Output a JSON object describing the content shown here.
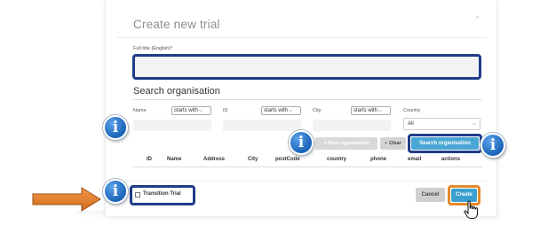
{
  "modal": {
    "title": "Create new trial",
    "close_icon": "close-icon"
  },
  "full_title": {
    "label": "Full title (English)*",
    "value": ""
  },
  "search": {
    "section_title": "Search organisation",
    "name": {
      "label": "Name",
      "operator": "starts with",
      "value": ""
    },
    "id": {
      "label": "ID",
      "operator": "starts with",
      "value": ""
    },
    "city": {
      "label": "City",
      "operator": "starts with",
      "value": ""
    },
    "country": {
      "label": "Country",
      "value": "All"
    },
    "new_org_label": "+ New organisation",
    "clear_label": "Clear",
    "search_label": "Search organisation"
  },
  "table": {
    "columns": [
      "ID",
      "Name",
      "Address",
      "City",
      "postCode",
      "country",
      "phone",
      "email",
      "actions"
    ]
  },
  "footer": {
    "transition_label": "Transition Trial",
    "transition_checked": false,
    "cancel_label": "Cancel",
    "create_label": "Create"
  },
  "annotations": {
    "info_glyph": "i",
    "info_color": "#1a63b8",
    "highlight_color": "#1f3c88",
    "create_highlight_color": "#e6892b",
    "arrow_color": "#e07b27"
  }
}
